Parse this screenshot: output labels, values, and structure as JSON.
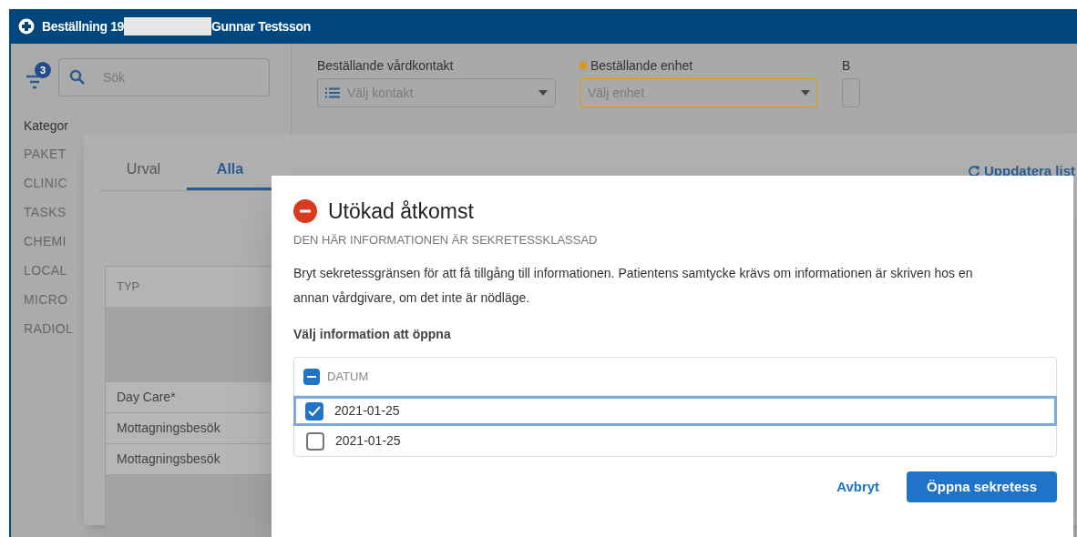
{
  "window": {
    "title_start": "Beställning 19",
    "title_end": "Gunnar Testsson"
  },
  "sidebar": {
    "filter_count": "3",
    "search": {
      "placeholder": "Sök"
    },
    "heading": "Kategor",
    "items": [
      "PAKET",
      "CLINIC",
      "TASKS",
      "CHEMI",
      "LOCAL",
      "MICRO",
      "RADIOL"
    ]
  },
  "form_fields": [
    {
      "label": "Beställande vårdkontakt",
      "placeholder": "Välj kontakt",
      "required": false,
      "kind": "list"
    },
    {
      "label": "Beställande enhet",
      "placeholder": "Välj enhet",
      "required": true,
      "kind": "plain"
    },
    {
      "label": "B",
      "required": false,
      "kind": "cut"
    }
  ],
  "panel": {
    "tabs": [
      {
        "label": "Urval",
        "selected": false
      },
      {
        "label": "Alla",
        "selected": true
      }
    ],
    "refresh_link": "Uppdatera list",
    "table": {
      "columns": [
        "TYP"
      ],
      "rows": [
        {
          "kind": "blank"
        },
        {
          "kind": "text",
          "cell": "Day Care*"
        },
        {
          "kind": "text",
          "cell": "Mottagningsbesök"
        },
        {
          "kind": "text",
          "cell": "Mottagningsbesök"
        },
        {
          "kind": "blank"
        }
      ]
    }
  },
  "dialog": {
    "title": "Utökad åtkomst",
    "subtitle": "DEN HÄR INFORMATIONEN ÄR SEKRETESSKLASSAD",
    "body": "Bryt sekretessgränsen för att få tillgång till informationen. Patientens samtycke krävs om informationen är skriven hos en annan vårdgivare, om det inte är nödläge.",
    "section_label": "Välj information att öppna",
    "list": {
      "header": {
        "label": "DATUM",
        "indeterminate": true
      },
      "rows": [
        {
          "label": "2021-01-25",
          "checked": true,
          "focused": true
        },
        {
          "label": "2021-01-25",
          "checked": false,
          "focused": false
        }
      ]
    },
    "buttons": [
      {
        "label": "Avbryt",
        "kind": "text"
      },
      {
        "label": "Öppna sekretess",
        "kind": "primary"
      }
    ]
  }
}
